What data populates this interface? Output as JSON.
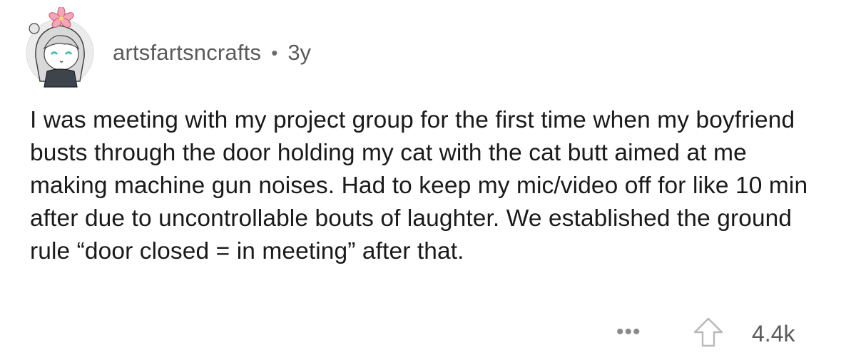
{
  "comment": {
    "author": "artsfartsncrafts",
    "separator": "•",
    "age": "3y",
    "body": "I was meeting with my project group for the first time when my boyfriend busts through the door holding my cat with the cat butt aimed at me making machine gun noises. Had to keep my mic/video off for like 10 min after due to uncontrollable bouts of laughter. We established the ground rule “door closed = in meeting” after that.",
    "actions": {
      "more_label": "•••",
      "upvote_icon": "upvote-arrow-icon",
      "score": "4.4k"
    }
  }
}
